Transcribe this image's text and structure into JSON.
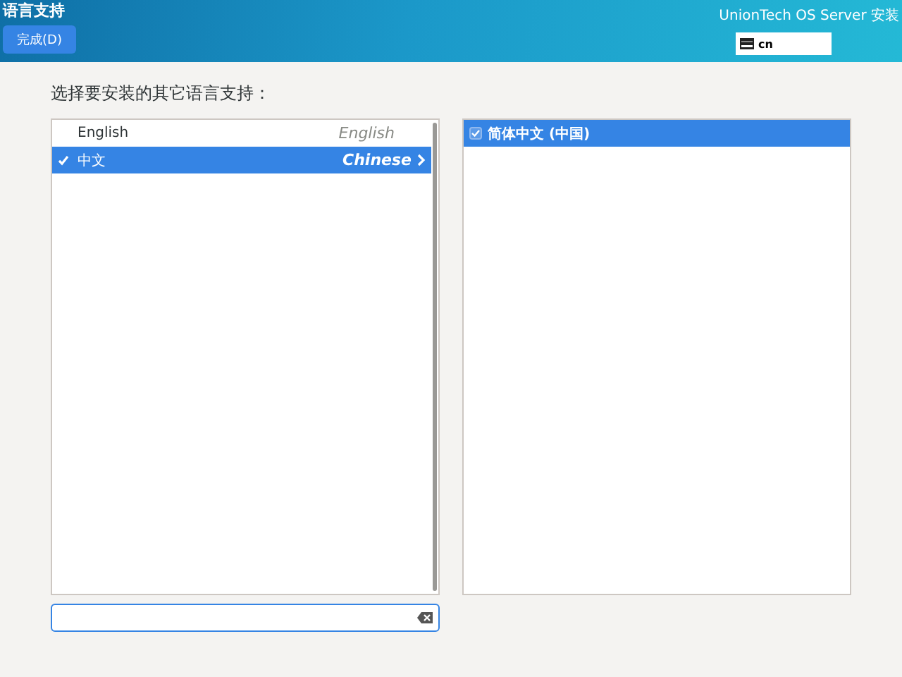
{
  "header": {
    "title": "语言支持",
    "done_button": "完成(D)",
    "product": "UnionTech OS Server 安装",
    "keyboard_layout": "cn"
  },
  "prompt": "选择要安装的其它语言支持：",
  "languages": [
    {
      "name": "English",
      "native": "English",
      "checked": false,
      "selected": false
    },
    {
      "name": "中文",
      "native": "Chinese",
      "checked": true,
      "selected": true
    }
  ],
  "locales": [
    {
      "name": "简体中文 (中国)",
      "checked": true,
      "selected": true
    }
  ]
}
